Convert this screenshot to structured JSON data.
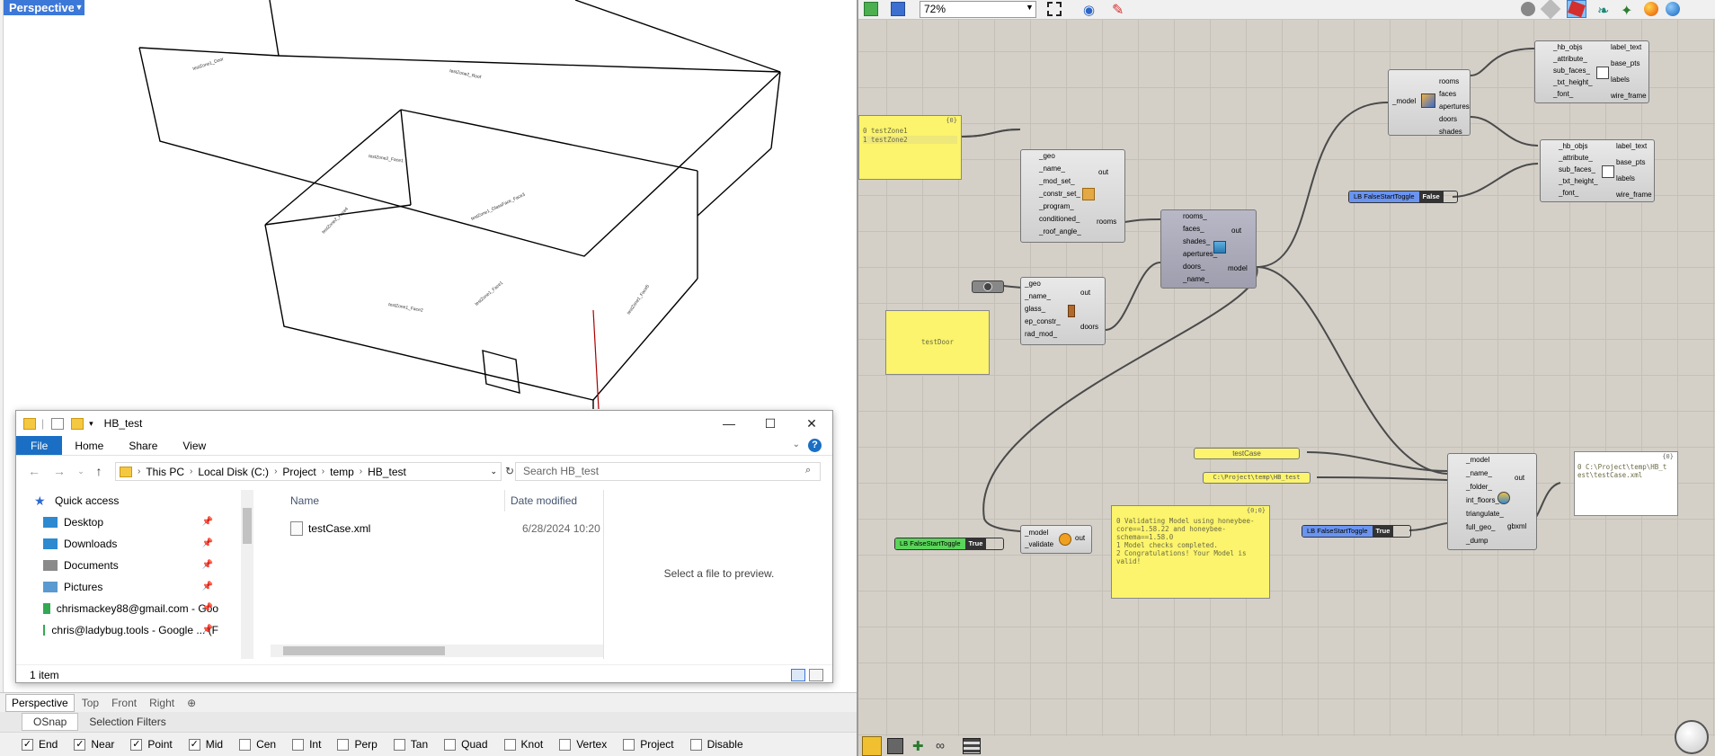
{
  "rhino": {
    "viewport_title": "Perspective",
    "tabs": [
      "Perspective",
      "Top",
      "Front",
      "Right"
    ],
    "add_tab": "⊕",
    "osnap_tabs": [
      "OSnap",
      "Selection Filters"
    ],
    "snaps": [
      {
        "label": "End",
        "checked": true
      },
      {
        "label": "Near",
        "checked": true
      },
      {
        "label": "Point",
        "checked": true
      },
      {
        "label": "Mid",
        "checked": true
      },
      {
        "label": "Cen",
        "checked": false
      },
      {
        "label": "Int",
        "checked": false
      },
      {
        "label": "Perp",
        "checked": false
      },
      {
        "label": "Tan",
        "checked": false
      },
      {
        "label": "Quad",
        "checked": false
      },
      {
        "label": "Knot",
        "checked": false
      },
      {
        "label": "Vertex",
        "checked": false
      },
      {
        "label": "Project",
        "checked": false
      },
      {
        "label": "Disable",
        "checked": false
      }
    ],
    "face_labels": [
      "testZone1_Door",
      "testZone2_Face1",
      "testZone2_Roof",
      "testZone1_GlassFace_Face3",
      "testZone1_Face2",
      "testZone2_Face4",
      "testZone1_Face1",
      "testZone1_Face5"
    ]
  },
  "explorer": {
    "title": "HB_test",
    "ribbon": [
      "File",
      "Home",
      "Share",
      "View"
    ],
    "breadcrumb": [
      "This PC",
      "Local Disk (C:)",
      "Project",
      "temp",
      "HB_test"
    ],
    "search_placeholder": "Search HB_test",
    "nav_items": [
      {
        "label": "Quick access",
        "icon": "star-icon",
        "pinned": false
      },
      {
        "label": "Desktop",
        "icon": "desktop-icon",
        "pinned": true
      },
      {
        "label": "Downloads",
        "icon": "download-icon",
        "pinned": true
      },
      {
        "label": "Documents",
        "icon": "documents-icon",
        "pinned": true
      },
      {
        "label": "Pictures",
        "icon": "pictures-icon",
        "pinned": true
      },
      {
        "label": "chrismackey88@gmail.com - Goo",
        "icon": "google-drive-icon",
        "pinned": true
      },
      {
        "label": "chris@ladybug.tools - Google ... (F",
        "icon": "google-drive-icon",
        "pinned": true
      }
    ],
    "columns": [
      "Name",
      "Date modified"
    ],
    "files": [
      {
        "name": "testCase.xml",
        "date": "6/28/2024 10:20"
      }
    ],
    "preview_text": "Select a file to preview.",
    "status": "1 item"
  },
  "gh": {
    "zoom": "72%",
    "panel_zones": {
      "header": "{0}",
      "lines": [
        "0 testZone1",
        "1 testZone2"
      ]
    },
    "panel_door": "testDoor",
    "room_comp": {
      "inputs": [
        "_geo",
        "_name_",
        "_mod_set_",
        "_constr_set_",
        "_program_",
        "conditioned_",
        "_roof_angle_"
      ],
      "outputs": [
        "out",
        "rooms"
      ]
    },
    "door_comp": {
      "inputs": [
        "_geo",
        "_name_",
        "glass_",
        "ep_constr_",
        "rad_mod_"
      ],
      "outputs": [
        "out",
        "doors"
      ]
    },
    "model_comp": {
      "inputs": [
        "rooms_",
        "faces_",
        "shades_",
        "apertures_",
        "doors_",
        "_name_"
      ],
      "outputs": [
        "out",
        "model"
      ]
    },
    "deconstruct_comp": {
      "inputs": [
        "_model"
      ],
      "outputs": [
        "rooms",
        "faces",
        "apertures",
        "doors",
        "shades"
      ]
    },
    "label1_comp": {
      "inputs": [
        "_hb_objs",
        "_attribute_",
        "sub_faces_",
        "_txt_height_",
        "_font_"
      ],
      "outputs": [
        "label_text",
        "base_pts",
        "labels",
        "wire_frame"
      ]
    },
    "label2_comp": {
      "inputs": [
        "_hb_objs",
        "_attribute_",
        "sub_faces_",
        "_txt_height_",
        "_font_"
      ],
      "outputs": [
        "label_text",
        "base_pts",
        "labels",
        "wire_frame"
      ]
    },
    "toggle_false": {
      "name": "LB FalseStartToggle",
      "value": "False"
    },
    "toggle_validate": {
      "name": "LB FalseStartToggle",
      "value": "True"
    },
    "toggle_gbxml": {
      "name": "LB FalseStartToggle",
      "value": "True"
    },
    "validate_comp": {
      "inputs": [
        "_model",
        "_validate"
      ],
      "outputs": [
        "out"
      ]
    },
    "validate_panel": {
      "header": "{0;0}",
      "lines": [
        "0 Validating Model using honeybee-",
        "  core==1.58.22 and honeybee-",
        "  schema==1.58.0",
        "1 Model checks completed.",
        "2 Congratulations! Your Model is",
        "  valid!"
      ]
    },
    "param_name": "testCase",
    "param_folder": "C:\\Project\\temp\\HB_test",
    "gbxml_comp": {
      "inputs": [
        "_model",
        "_name_",
        "_folder_",
        "int_floors_",
        "triangulate_",
        "full_geo_",
        "_dump"
      ],
      "outputs": [
        "out",
        "gbxml"
      ]
    },
    "out_panel": {
      "header": "{0}",
      "lines": [
        "0 C:\\Project\\temp\\HB_t",
        "  est\\testCase.xml"
      ]
    }
  }
}
